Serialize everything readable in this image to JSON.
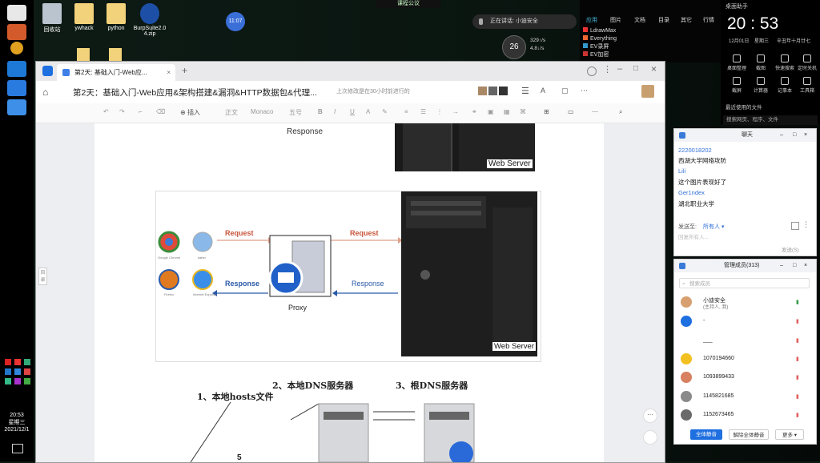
{
  "desktop": {
    "icons": [
      {
        "label": "回收站"
      },
      {
        "label": "ywhack"
      },
      {
        "label": "python"
      },
      {
        "label": "BurpSuite2.0\n4.zip"
      }
    ],
    "timer_badge": "11:07",
    "top_strip": "课程公议",
    "speaking": "正在讲话: 小迪安全",
    "weather": "26",
    "net_up": "329↑/s",
    "net_down": "4.8↓/s"
  },
  "sidebar_clock": {
    "time": "20:53",
    "day": "星期三",
    "date": "2021/12/1"
  },
  "apps_panel": {
    "tabs": [
      "应用",
      "图片",
      "文档",
      "目录",
      "其它",
      "行情"
    ],
    "items": [
      "LdrawMax",
      "Everything",
      "EV录屏",
      "EV加密"
    ]
  },
  "clock_widget": {
    "title": "桌面助手",
    "time": "20 : 53",
    "date": "12月01日",
    "weekday": "星期三",
    "lunar": "辛丑年十月廿七",
    "quick": [
      "桌面整理",
      "截图",
      "快速搜索",
      "定时关机",
      "截屏",
      "计算器",
      "记事本",
      "工具箱"
    ],
    "recent": "最近使用的文件",
    "search_placeholder": "搜索网页、程序、文件"
  },
  "window": {
    "tab_label": "第2天: 基础入门-Web应...",
    "doc_title": "第2天：基础入门-Web应用&架构搭建&漏洞&HTTP数据包&代理...",
    "save_status": "上次修改是在30小时前进行的",
    "share_label": "分享",
    "toolbar": {
      "insert": "插入",
      "style": "正文",
      "font": "Monaco",
      "size": "五号"
    },
    "side_handle": "目录"
  },
  "document": {
    "diagram1": {
      "response": "Response",
      "server": "Web Server"
    },
    "diagram2": {
      "request_left": "Request",
      "request_right": "Request",
      "response_left": "Response",
      "response_right": "Response",
      "proxy": "Proxy",
      "server": "Web Server",
      "browsers": [
        "Google Chrome",
        "safari",
        "Firefox",
        "Internet Explorer"
      ]
    },
    "diagram3": {
      "step1": "1、本地hosts文件",
      "step2": "2、本地DNS服务器",
      "step3": "3、根DNS服务器",
      "step5": "5"
    }
  },
  "chat": {
    "title": "聊天",
    "messages": [
      {
        "user": "2220018202",
        "text": "西湖大学网络攻防"
      },
      {
        "user": "Lili",
        "text": "这个图片表现好了"
      },
      {
        "user": "Ger1ndex",
        "text": "湖北职业大学"
      }
    ],
    "send_to_label": "发送至:",
    "send_to_value": "所有人",
    "input_placeholder": "回复所有人...",
    "send_button": "发送(S)"
  },
  "members": {
    "title": "管理成员(313)",
    "search_placeholder": "搜索成员",
    "list": [
      {
        "name": "小迪安全",
        "role": "(主持人, 我)"
      },
      {
        "name": "-",
        "role": ""
      },
      {
        "name": "___",
        "role": ""
      },
      {
        "name": "1070194660",
        "role": ""
      },
      {
        "name": "1093899433",
        "role": ""
      },
      {
        "name": "1145821685",
        "role": ""
      },
      {
        "name": "1152673465",
        "role": ""
      }
    ],
    "mute_all": "全体静音",
    "unmute_all": "解除全体静音",
    "more": "更多"
  }
}
